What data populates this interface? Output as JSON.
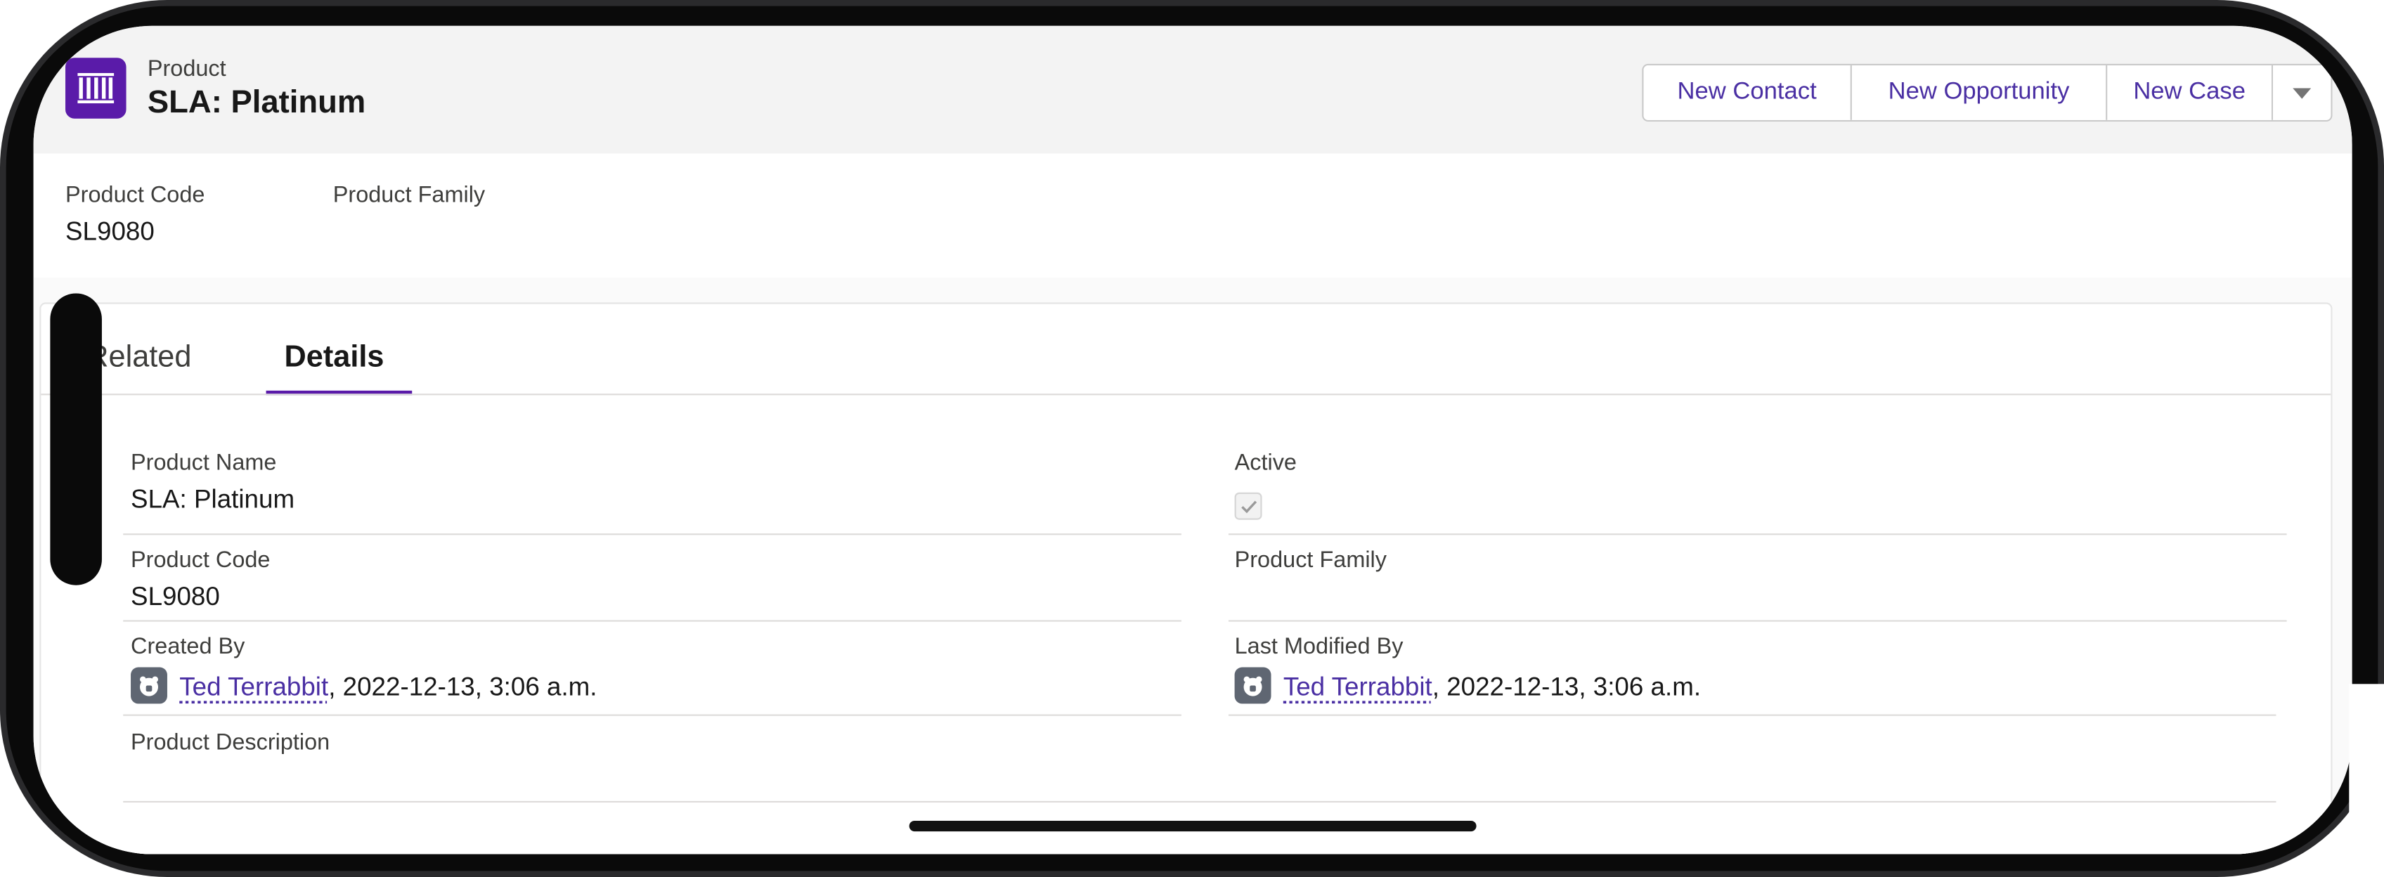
{
  "header": {
    "object_label": "Product",
    "record_title": "SLA: Platinum",
    "actions": [
      "New Contact",
      "New Opportunity",
      "New Case"
    ]
  },
  "highlights": {
    "fields": [
      {
        "label": "Product Code",
        "value": "SL9080"
      },
      {
        "label": "Product Family",
        "value": ""
      }
    ]
  },
  "tabs": {
    "related": "Related",
    "details": "Details"
  },
  "details": {
    "product_name_label": "Product Name",
    "product_name_value": "SLA: Platinum",
    "active_label": "Active",
    "active_checked": true,
    "product_code_label": "Product Code",
    "product_code_value": "SL9080",
    "product_family_label": "Product Family",
    "product_family_value": "",
    "created_by_label": "Created By",
    "created_by_user": "Ted Terrabbit",
    "created_by_date": ", 2022-12-13, 3:06 a.m.",
    "modified_by_label": "Last Modified By",
    "modified_by_user": "Ted Terrabbit",
    "modified_by_date": ", 2022-12-13, 3:06 a.m.",
    "description_label": "Product Description",
    "description_value": ""
  },
  "colors": {
    "brand": "#5a1ba9",
    "link": "#4a2fa3"
  },
  "icons": {
    "object_icon": "product-icon",
    "actions_overflow": "chevron-down-icon",
    "avatar": "user-avatar-icon",
    "checkbox_check": "check-icon"
  }
}
